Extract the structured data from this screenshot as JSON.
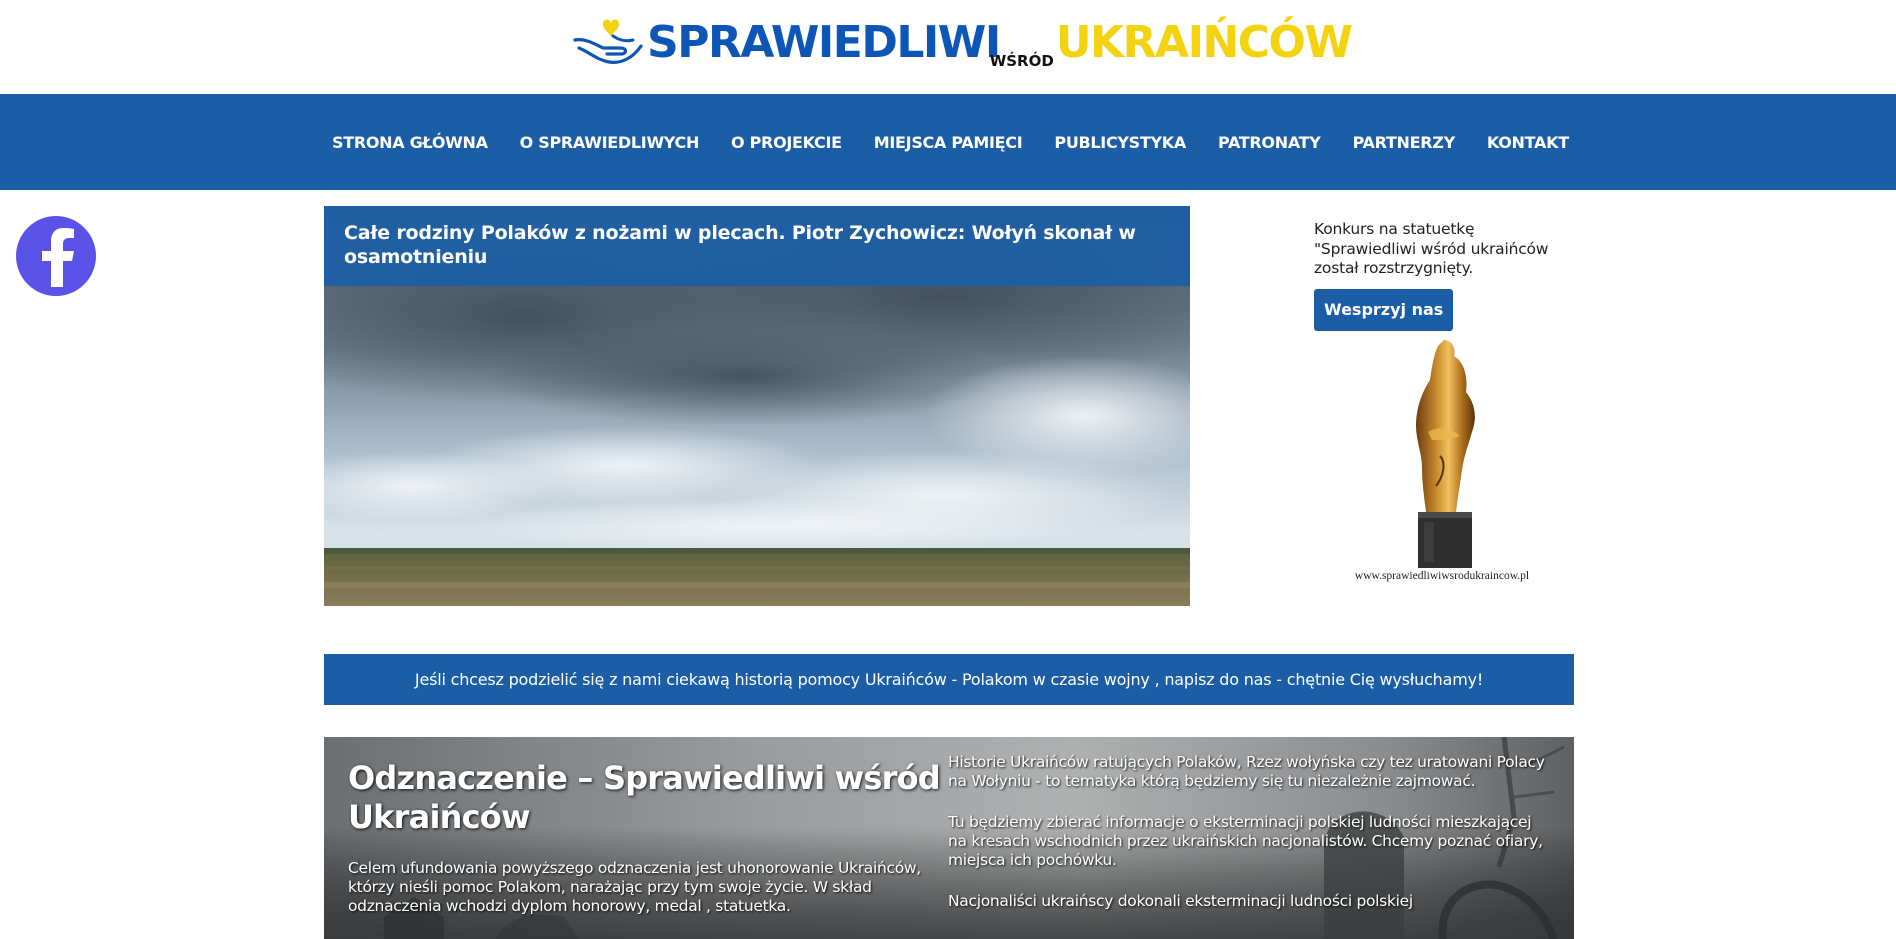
{
  "header": {
    "logo_part1": "SPRAWIEDLIWI",
    "logo_small": "WŚRÓD",
    "logo_part2": "UKRAIŃCÓW",
    "colors": {
      "blue": "#0d56b5",
      "yellow": "#f3d20f"
    }
  },
  "nav": {
    "items": [
      {
        "label": "STRONA GŁÓWNA"
      },
      {
        "label": "O SPRAWIEDLIWYCH"
      },
      {
        "label": "O PROJEKCIE"
      },
      {
        "label": "MIEJSCA PAMIĘCI"
      },
      {
        "label": "PUBLICYSTYKA"
      },
      {
        "label": "PATRONATY"
      },
      {
        "label": "PARTNERZY"
      },
      {
        "label": "KONTAKT"
      }
    ],
    "background": "#1c5ea6"
  },
  "social": {
    "icon": "facebook-icon",
    "color": "#5b52e8"
  },
  "featured": {
    "title": "Całe rodziny Polaków z nożami w plecach. Piotr Zychowicz: Wołyń skonał w osamotnieniu",
    "image_icon": "landscape-photo"
  },
  "sidebar": {
    "text": "Konkurs na statuetkę \"Sprawiedliwi wśród ukraińców został rozstrzygnięty.",
    "button_label": "Wesprzyj nas",
    "statuette_url": "www.sprawiedliwiwsrodukraincow.pl"
  },
  "banner": {
    "text": "Jeśli chcesz podzielić się z nami ciekawą historią pomocy Ukraińców - Polakom w czasie wojny , napisz do nas - chętnie Cię wysłuchamy!"
  },
  "award": {
    "heading": "Odznaczenie – Sprawiedliwi wśród Ukraińców",
    "description": "Celem ufundowania powyższego odznaczenia jest uhonorowanie Ukraińców, którzy nieśli pomoc Polakom, narażając przy tym swoje życie. W skład odznaczenia wchodzi dyplom honorowy, medal , statuetka.",
    "paragraph1": "Historie Ukraińców ratujących Polaków, Rzez wołyńska czy tez uratowani Polacy na Wołyniu - to tematyka którą będziemy się tu niezależnie zajmować.",
    "paragraph2": "Tu będziemy zbierać informacje o eksterminacji polskiej ludności mieszkającej na kresach wschodnich przez ukraińskich nacjonalistów. Chcemy poznać ofiary, miejsca ich pochówku.",
    "paragraph3": "Nacjonaliści ukraińscy dokonali eksterminacji ludności polskiej"
  }
}
